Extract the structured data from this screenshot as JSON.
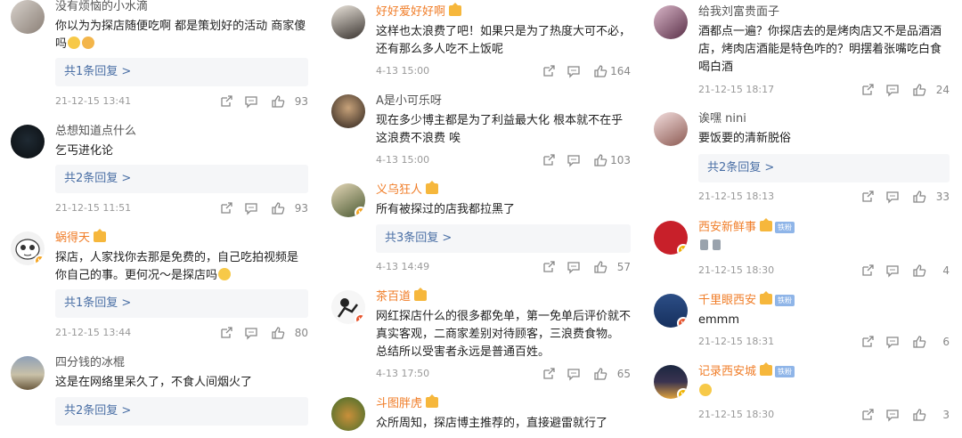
{
  "columns": [
    {
      "comments": [
        {
          "user": "没有烦恼的小水滴",
          "text": "你以为为探店随便吃啊 都是策划好的活动 商家傻吗",
          "reply": "共1条回复 >",
          "date": "21-12-15 13:41",
          "likes": "93"
        },
        {
          "user": "总想知道点什么",
          "text": "乞丐进化论",
          "reply": "共2条回复 >",
          "date": "21-12-15 11:51",
          "likes": "93"
        },
        {
          "user": "蜗得天",
          "text": "探店，人家找你去那是免费的，自己吃拍视频是你自己的事。更何况～是探店吗",
          "reply": "共1条回复 >",
          "date": "21-12-15 13:44",
          "likes": "80"
        },
        {
          "user": "四分钱的冰棍",
          "text": "这是在网络里呆久了，不食人间烟火了",
          "reply": "共2条回复 >",
          "date": "",
          "likes": ""
        }
      ]
    },
    {
      "comments": [
        {
          "user": "好好爱好好啊",
          "text": "这样也太浪费了吧！如果只是为了热度大可不必，还有那么多人吃不上饭呢",
          "date": "4-13 15:00",
          "likes": "164"
        },
        {
          "user": "A是小可乐呀",
          "text": "现在多少博主都是为了利益最大化 根本就不在乎这浪费不浪费 唉",
          "date": "4-13 15:00",
          "likes": "103"
        },
        {
          "user": "义乌狂人",
          "text": "所有被探过的店我都拉黑了",
          "reply": "共3条回复 >",
          "date": "4-13 14:49",
          "likes": "57"
        },
        {
          "user": "茶百道",
          "text": "网红探店什么的很多都免单，第一免单后评价就不真实客观，二商家差别对待顾客，三浪费食物。 总结所以受害者永远是普通百姓。",
          "date": "4-13 17:50",
          "likes": "65"
        },
        {
          "user": "斗图胖虎",
          "text": "众所周知，探店博主推荐的，直接避雷就行了",
          "date": "",
          "likes": ""
        }
      ]
    },
    {
      "comments": [
        {
          "user": "给我刘富贵面子",
          "text": "酒都点一遍？你探店去的是烤肉店又不是品酒酒店，烤肉店酒能是特色咋的？明摆着张嘴吃白食喝白酒",
          "date": "21-12-15 18:17",
          "likes": "24"
        },
        {
          "user": "诶嘿 nini",
          "text": "要饭要的清新脱俗",
          "reply": "共2条回复 >",
          "date": "21-12-15 18:13",
          "likes": "33"
        },
        {
          "user": "西安新鲜事",
          "text": "",
          "date": "21-12-15 18:30",
          "likes": "4"
        },
        {
          "user": "千里眼西安",
          "text": "emmm",
          "date": "21-12-15 18:31",
          "likes": "6"
        },
        {
          "user": "记录西安城",
          "text": "",
          "date": "21-12-15 18:30",
          "likes": "3"
        }
      ]
    }
  ],
  "fan_tag": "铁粉",
  "colors": {
    "accent_orange": "#f07d28",
    "reply_blue": "#4a6fa5",
    "reply_bg": "#f5f6f8",
    "meta_gray": "#999999"
  }
}
